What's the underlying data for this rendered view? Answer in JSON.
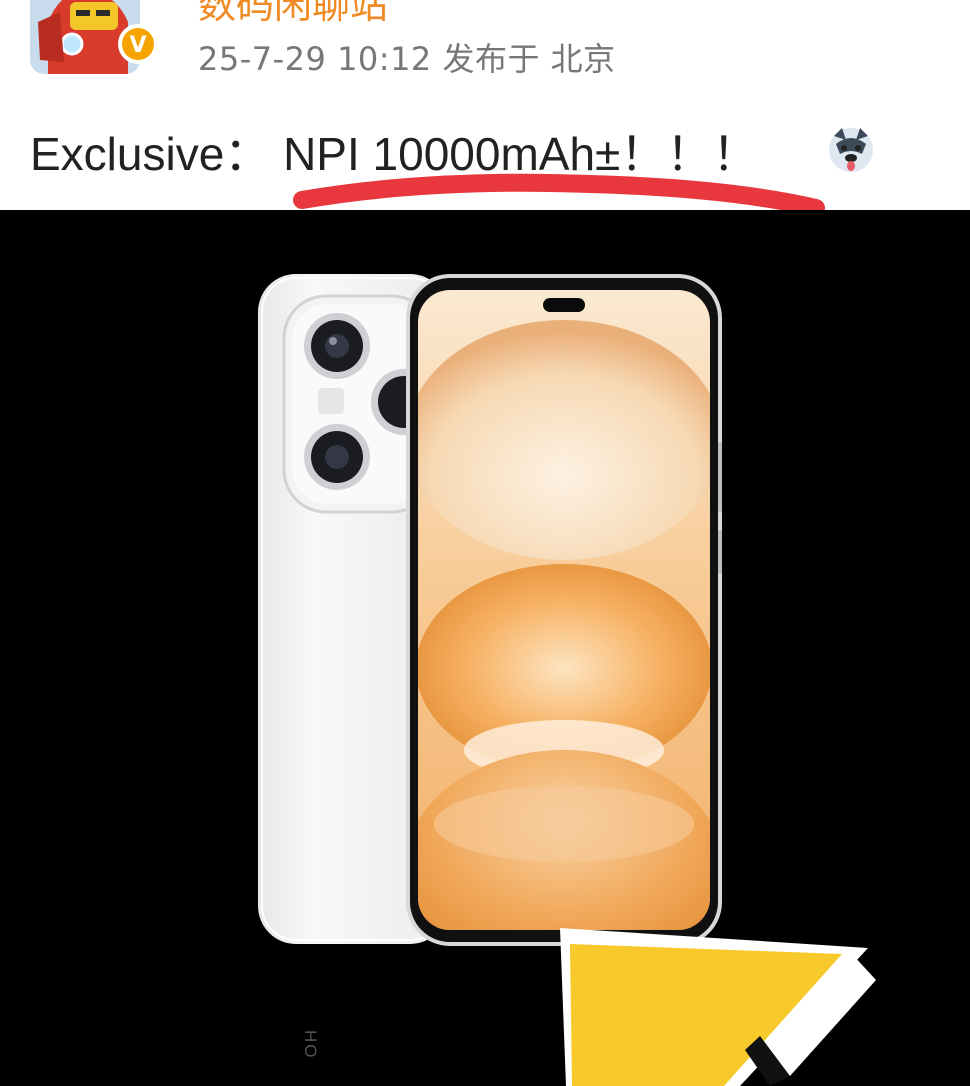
{
  "post": {
    "username": "数码闲聊站",
    "meta": "25-7-29 10:12  发布于 北京",
    "text": "Exclusive： NPI 10000mAh±！！！"
  },
  "media": {
    "brand_text": "HO"
  },
  "colors": {
    "underline": "#e8383d",
    "accent": "#f08a24",
    "badge": "#f5a400",
    "overlay_yellow": "#f7c92a"
  }
}
